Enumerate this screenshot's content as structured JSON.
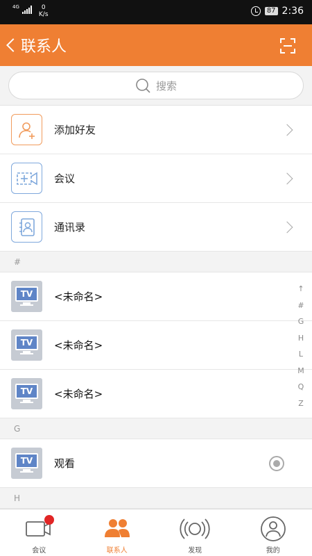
{
  "status_bar": {
    "network": "4G",
    "speed_value": "0",
    "speed_unit": "K/s",
    "battery": "87",
    "time": "2:36"
  },
  "header": {
    "title": "联系人"
  },
  "search": {
    "placeholder": "搜索"
  },
  "menu": [
    {
      "label": "添加好友"
    },
    {
      "label": "会议"
    },
    {
      "label": "通讯录"
    }
  ],
  "sections": [
    {
      "letter": "#",
      "contacts": [
        "<未命名>",
        "<未命名>",
        "<未命名>"
      ]
    },
    {
      "letter": "G",
      "contacts": [
        "观看"
      ]
    },
    {
      "letter": "H",
      "contacts": []
    }
  ],
  "avatar_text": "TV",
  "index_bar": [
    "↑",
    "#",
    "G",
    "H",
    "L",
    "M",
    "Q",
    "Z"
  ],
  "bottom_nav": [
    {
      "label": "会议"
    },
    {
      "label": "联系人"
    },
    {
      "label": "发现"
    },
    {
      "label": "我的"
    }
  ],
  "colors": {
    "accent": "#ef7f33",
    "badge": "#e12525",
    "tv_screen": "#5f85c7"
  }
}
